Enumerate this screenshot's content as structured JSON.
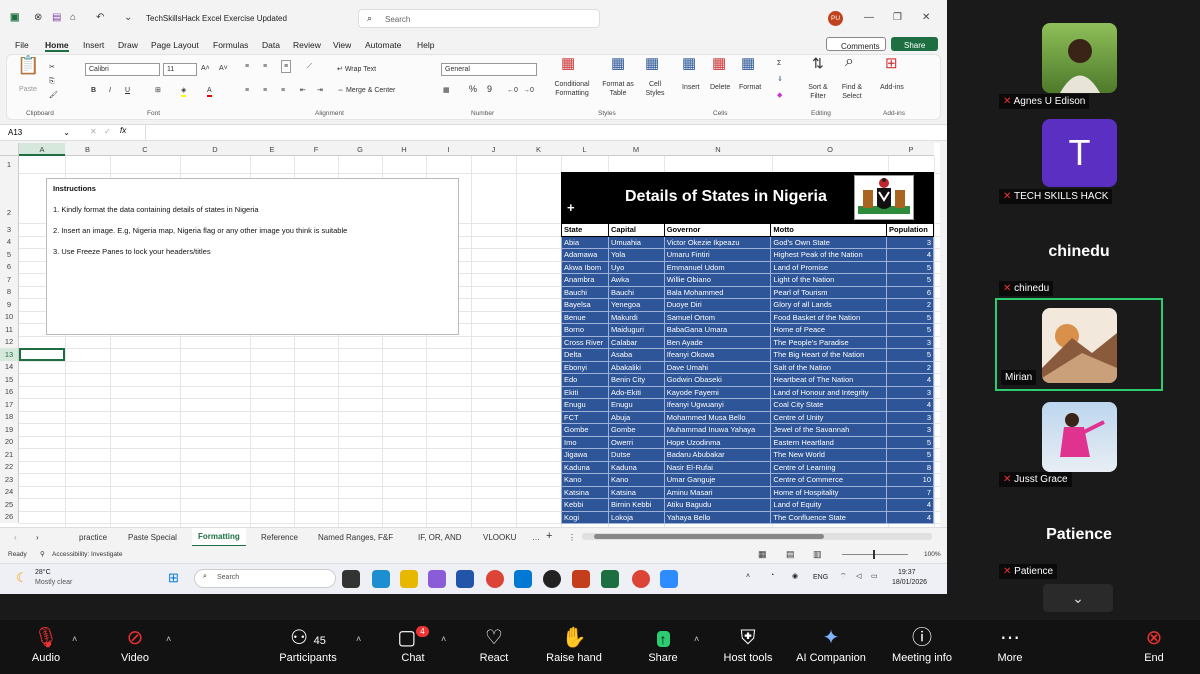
{
  "excel": {
    "title": "TechSkillsHack Excel Exercise Updated",
    "search_placeholder": "Search",
    "avatar": "PU",
    "tabs": [
      "File",
      "Home",
      "Insert",
      "Draw",
      "Page Layout",
      "Formulas",
      "Data",
      "Review",
      "View",
      "Automate",
      "Help"
    ],
    "comments": "Comments",
    "share": "Share",
    "font": "Calibri",
    "font_size": "11",
    "number_format": "General",
    "ribbon": {
      "paste": "Paste",
      "clipboard": "Clipboard",
      "font": "Font",
      "wrap": "Wrap Text",
      "merge": "Merge & Center",
      "alignment": "Alignment",
      "number": "Number",
      "cond": "Conditional Formatting",
      "fmt_table": "Format as Table",
      "cell_styles": "Cell Styles",
      "styles": "Styles",
      "insert": "Insert",
      "delete": "Delete",
      "format": "Format",
      "cells": "Cells",
      "sort": "Sort & Filter",
      "find": "Find & Select",
      "editing": "Editing",
      "addins": "Add-ins",
      "addins_grp": "Add-ins"
    },
    "name_box": "A13",
    "columns": [
      "A",
      "B",
      "C",
      "D",
      "E",
      "F",
      "G",
      "H",
      "I",
      "J",
      "K",
      "L",
      "M",
      "N",
      "O",
      "P"
    ],
    "rows": [
      "1",
      "2",
      "3",
      "4",
      "5",
      "6",
      "7",
      "8",
      "9",
      "10",
      "11",
      "12",
      "13",
      "14",
      "15",
      "16",
      "17",
      "18",
      "19",
      "20",
      "21",
      "22",
      "23",
      "24",
      "25",
      "26"
    ],
    "instructions": {
      "heading": "Instructions",
      "items": [
        "1. Kindly format the data containing details of states in Nigeria",
        "2. Insert an image. E.g, Nigeria map, Nigeria flag or any other image you think is suitable",
        "3. Use Freeze Panes to lock your headers/titles"
      ]
    },
    "banner_title": "Details of States in Nigeria",
    "table_headers": [
      "State",
      "Capital",
      "Governor",
      "Motto",
      "Population"
    ],
    "table_rows": [
      [
        "Abia",
        "Umuahia",
        "Victor Okezie Ikpeazu",
        "God's Own State",
        "3"
      ],
      [
        "Adamawa",
        "Yola",
        "Umaru Fintiri",
        "Highest Peak of the Nation",
        "4"
      ],
      [
        "Akwa Ibom",
        "Uyo",
        "Emmanuel Udom",
        "Land of Promise",
        "5"
      ],
      [
        "Anambra",
        "Awka",
        "Willie Obiano",
        "Light of the Nation",
        "5"
      ],
      [
        "Bauchi",
        "Bauchi",
        "Bala Mohammed",
        "Pearl of Tourism",
        "6"
      ],
      [
        "Bayelsa",
        "Yenegoa",
        "Duoye Diri",
        "Glory of all Lands",
        "2"
      ],
      [
        "Benue",
        "Makurdi",
        "Samuel Ortom",
        "Food Basket of the Nation",
        "5"
      ],
      [
        "Borno",
        "Maiduguri",
        "BabaGana Umara",
        "Home of Peace",
        "5"
      ],
      [
        "Cross River",
        "Calabar",
        "Ben Ayade",
        "The People's Paradise",
        "3"
      ],
      [
        "Delta",
        "Asaba",
        "Ifeanyi Okowa",
        "The Big Heart of the Nation",
        "5"
      ],
      [
        "Ebonyi",
        "Abakaliki",
        "Dave Umahi",
        "Salt of the Nation",
        "2"
      ],
      [
        "Edo",
        "Benin City",
        "Godwin Obaseki",
        "Heartbeat of The Nation",
        "4"
      ],
      [
        "Ekiti",
        "Ado-Ekiti",
        "Kayode Fayemi",
        "Land of Honour and Integrity",
        "3"
      ],
      [
        "Enugu",
        "Enugu",
        "Ifeanyi Ugwuanyi",
        "Coal City State",
        "4"
      ],
      [
        "FCT",
        "Abuja",
        "Mohammed Musa Bello",
        "Centre of Unity",
        "3"
      ],
      [
        "Gombe",
        "Gombe",
        "Muhammad Inuwa Yahaya",
        "Jewel of the Savannah",
        "3"
      ],
      [
        "Imo",
        "Owerri",
        "Hope Uzodinma",
        "Eastern Heartland",
        "5"
      ],
      [
        "Jigawa",
        "Dutse",
        "Badaru Abubakar",
        "The New World",
        "5"
      ],
      [
        "Kaduna",
        "Kaduna",
        "Nasir El-Rufai",
        "Centre of Learning",
        "8"
      ],
      [
        "Kano",
        "Kano",
        "Umar Ganguje",
        "Centre of Commerce",
        "10"
      ],
      [
        "Katsina",
        "Katsina",
        "Aminu Masari",
        "Home of Hospitality",
        "7"
      ],
      [
        "Kebbi",
        "Birnin Kebbi",
        "Atiku Bagudu",
        "Land of Equity",
        "4"
      ],
      [
        "Kogi",
        "Lokoja",
        "Yahaya Bello",
        "The Confluence State",
        "4"
      ]
    ],
    "sheets": [
      "practice",
      "Paste Special",
      "Formatting",
      "Reference",
      "Named Ranges, F&F",
      "IF, OR, AND",
      "VLOOKU"
    ],
    "status": "Ready",
    "accessibility": "Accessibility: Investigate",
    "zoom": "100%",
    "weather_temp": "28°C",
    "weather_desc": "Mostly clear",
    "tb_search": "Search",
    "lang": "ENG",
    "time": "19:37",
    "date": "18/01/2026"
  },
  "participants": [
    {
      "name": "Agnes U Edison"
    },
    {
      "name": "TECH SKILLS HACK",
      "initial": "T"
    },
    {
      "name": "chinedu",
      "big": "chinedu"
    },
    {
      "name": "Mirian"
    },
    {
      "name": "Jusst Grace"
    },
    {
      "name": "Patience",
      "big": "Patience"
    }
  ],
  "toolbar": {
    "audio": "Audio",
    "video": "Video",
    "participants": "Participants",
    "participants_count": "45",
    "chat": "Chat",
    "chat_badge": "4",
    "react": "React",
    "raise": "Raise hand",
    "share": "Share",
    "host": "Host tools",
    "ai": "AI Companion",
    "info": "Meeting info",
    "more": "More",
    "end": "End"
  }
}
